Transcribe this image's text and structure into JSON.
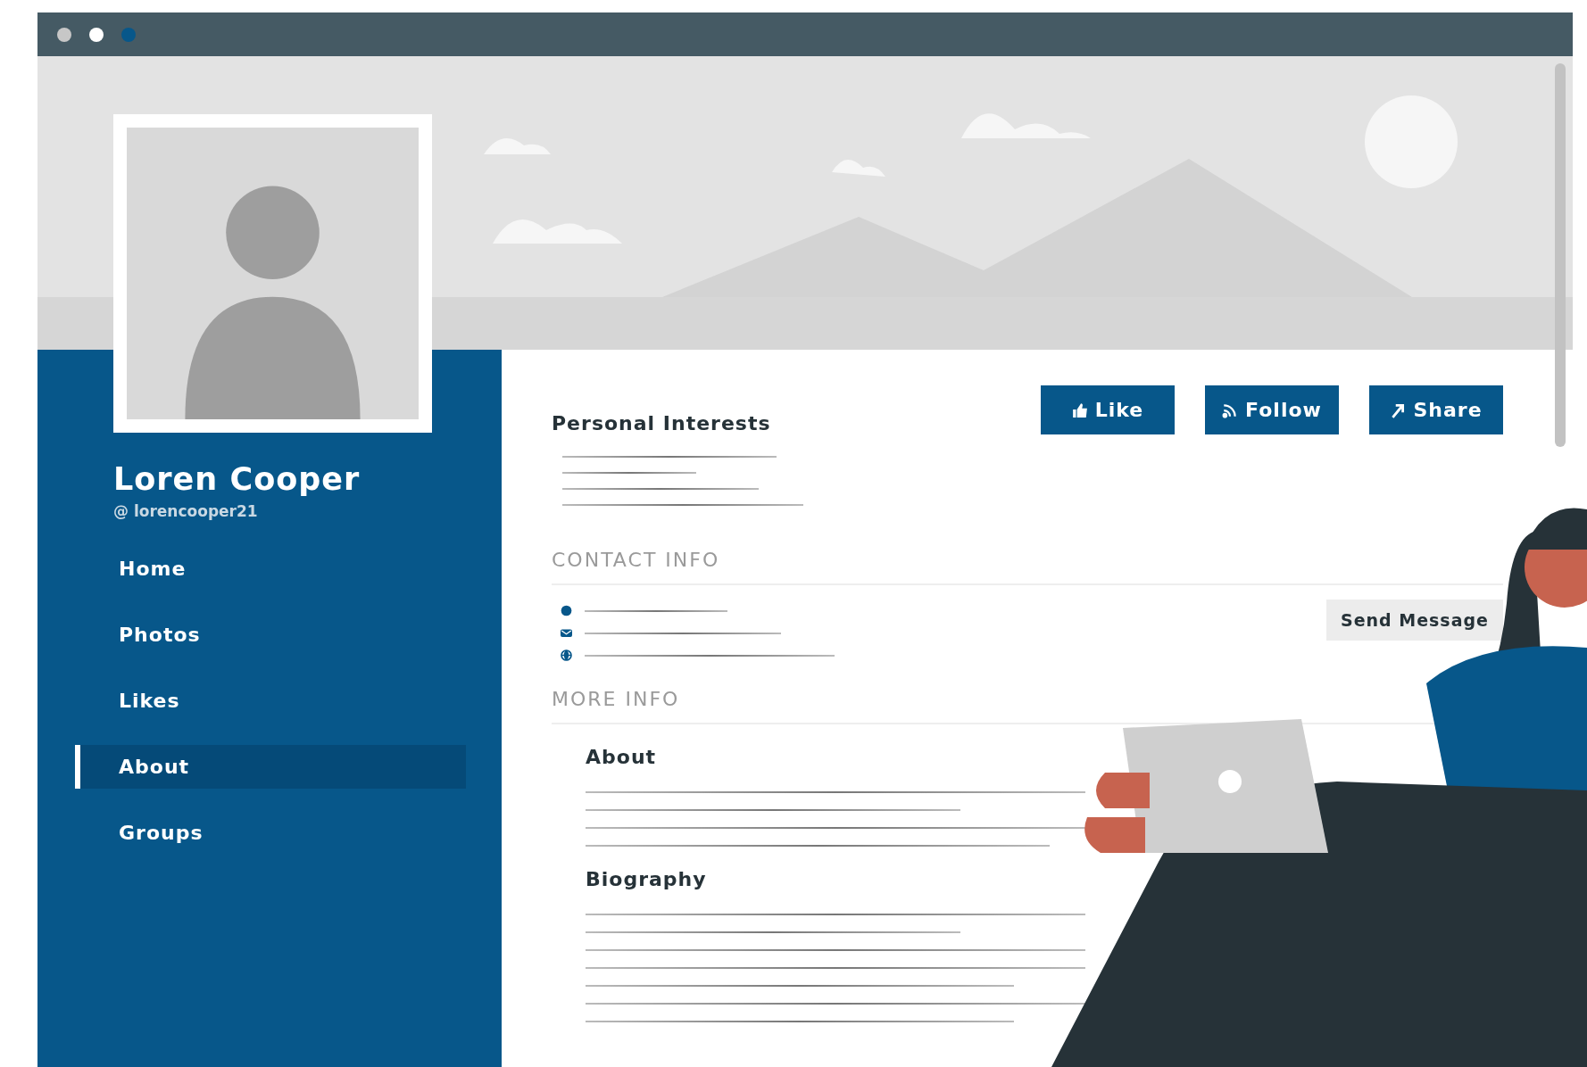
{
  "profile": {
    "name": "Loren Cooper",
    "handle": "@ lorencooper21"
  },
  "nav": [
    {
      "label": "Home",
      "selected": false
    },
    {
      "label": "Photos",
      "selected": false
    },
    {
      "label": "Likes",
      "selected": false
    },
    {
      "label": "About",
      "selected": true
    },
    {
      "label": "Groups",
      "selected": false
    }
  ],
  "interests": {
    "title": "Personal Interests"
  },
  "actions": [
    {
      "kind": "like",
      "label": "Like"
    },
    {
      "kind": "follow",
      "label": "Follow"
    },
    {
      "kind": "share",
      "label": "Share"
    }
  ],
  "contact": {
    "title": "CONTACT INFO",
    "items": [
      {
        "kind": "dot"
      },
      {
        "kind": "mail"
      },
      {
        "kind": "globe"
      }
    ],
    "button": "Send Message"
  },
  "more": {
    "title": "MORE INFO",
    "sections": [
      {
        "title": "About"
      },
      {
        "title": "Biography"
      }
    ]
  }
}
